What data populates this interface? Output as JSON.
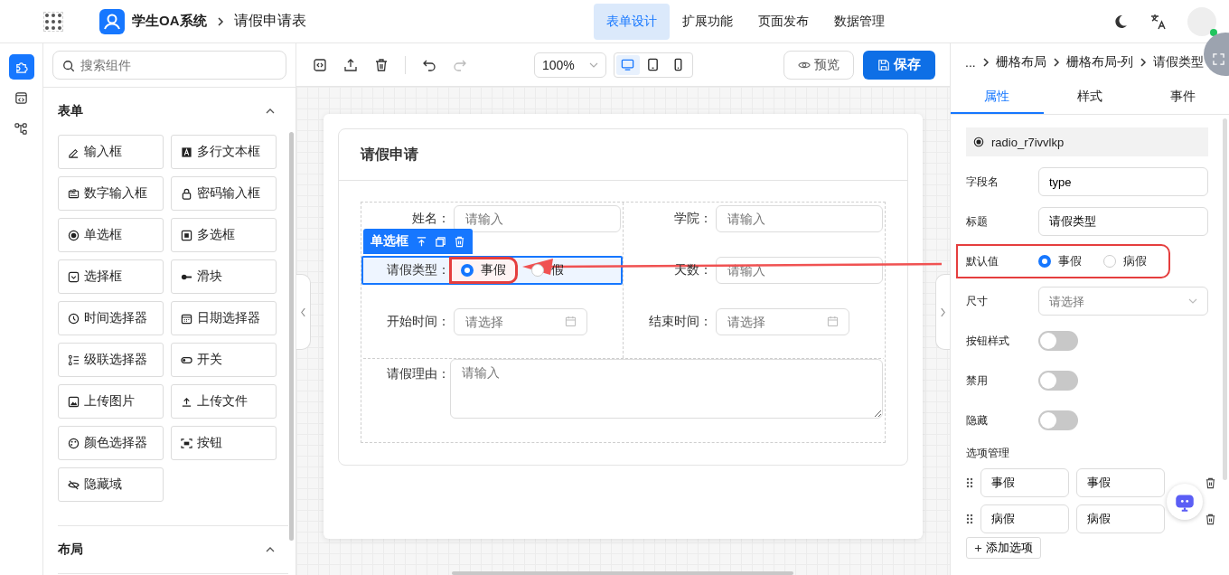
{
  "top_bar": {
    "app_name": "学生OA系统",
    "page_title": "请假申请表",
    "nav_tabs": [
      {
        "label": "表单设计",
        "selected": true
      },
      {
        "label": "扩展功能",
        "selected": false
      },
      {
        "label": "页面发布",
        "selected": false
      },
      {
        "label": "数据管理",
        "selected": false
      }
    ]
  },
  "sidebar_icons": [
    {
      "kind": "puzzle",
      "selected": true
    },
    {
      "kind": "code",
      "selected": false
    },
    {
      "kind": "tree",
      "selected": false
    }
  ],
  "component_panel": {
    "search": {
      "placeholder": "搜索组件"
    },
    "groups": [
      {
        "title": "表单",
        "expanded": true,
        "items": [
          {
            "label": "输入框",
            "kind": "pen"
          },
          {
            "label": "多行文本框",
            "kind": "textarea"
          },
          {
            "label": "数字输入框",
            "kind": "number"
          },
          {
            "label": "密码输入框",
            "kind": "lock"
          },
          {
            "label": "单选框",
            "kind": "radio"
          },
          {
            "label": "多选框",
            "kind": "checkbox"
          },
          {
            "label": "选择框",
            "kind": "select"
          },
          {
            "label": "滑块",
            "kind": "slider"
          },
          {
            "label": "时间选择器",
            "kind": "clock"
          },
          {
            "label": "日期选择器",
            "kind": "calendar"
          },
          {
            "label": "级联选择器",
            "kind": "cascade"
          },
          {
            "label": "开关",
            "kind": "switch"
          },
          {
            "label": "上传图片",
            "kind": "image"
          },
          {
            "label": "上传文件",
            "kind": "upload"
          },
          {
            "label": "颜色选择器",
            "kind": "palette"
          },
          {
            "label": "按钮",
            "kind": "button"
          },
          {
            "label": "隐藏域",
            "kind": "hidden"
          }
        ]
      },
      {
        "title": "布局",
        "expanded": true
      }
    ]
  },
  "toolbar": {
    "zoom": "100%",
    "devices": [
      {
        "kind": "desktop",
        "selected": true
      },
      {
        "kind": "tablet",
        "selected": false
      },
      {
        "kind": "phone",
        "selected": false
      }
    ],
    "preview": "预览",
    "save": "保存"
  },
  "form": {
    "title": "请假申请",
    "selection_toolbar": {
      "label": "单选框"
    },
    "columns": [
      {
        "fields": [
          {
            "label": "姓名：",
            "kind": "input",
            "placeholder": "请输入",
            "selected": false
          },
          {
            "label": "请假类型：",
            "kind": "radio",
            "selected": true,
            "options": [
              {
                "label": "事假",
                "selected": true,
                "highlighted": true
              },
              {
                "label": "假",
                "selected": false,
                "highlighted": false
              }
            ]
          },
          {
            "label": "开始时间：",
            "kind": "date",
            "placeholder": "请选择",
            "selected": false
          }
        ]
      },
      {
        "fields": [
          {
            "label": "学院：",
            "kind": "input",
            "placeholder": "请输入",
            "selected": false
          },
          {
            "label": "天数：",
            "kind": "input",
            "placeholder": "请输入",
            "selected": false
          },
          {
            "label": "结束时间：",
            "kind": "date",
            "placeholder": "请选择",
            "selected": false
          }
        ]
      }
    ],
    "full_width": [
      {
        "label": "请假理由：",
        "kind": "textarea",
        "placeholder": "请输入",
        "selected": false
      }
    ]
  },
  "properties": {
    "breadcrumb": [
      "...",
      "栅格布局",
      "栅格布局-列",
      "请假类型"
    ],
    "tabs": [
      {
        "label": "属性",
        "selected": true
      },
      {
        "label": "样式",
        "selected": false
      },
      {
        "label": "事件",
        "selected": false
      }
    ],
    "component_id": "radio_r7ivvlkp",
    "rows": [
      {
        "label": "字段名",
        "kind": "input",
        "value": "type",
        "highlighted": false
      },
      {
        "label": "标题",
        "kind": "input",
        "value": "请假类型",
        "highlighted": false
      },
      {
        "label": "默认值",
        "kind": "radio",
        "highlighted": true,
        "options": [
          {
            "label": "事假",
            "selected": true
          },
          {
            "label": "病假",
            "selected": false
          }
        ]
      },
      {
        "label": "尺寸",
        "kind": "select",
        "placeholder": "请选择",
        "highlighted": false
      },
      {
        "label": "按钮样式",
        "kind": "switch",
        "on": false,
        "highlighted": false
      },
      {
        "label": "禁用",
        "kind": "switch",
        "on": false,
        "highlighted": false
      },
      {
        "label": "隐藏",
        "kind": "switch",
        "on": false,
        "highlighted": false
      }
    ],
    "options_manager": {
      "title": "选项管理",
      "options": [
        {
          "label": "事假",
          "value": "事假"
        },
        {
          "label": "病假",
          "value": "病假"
        }
      ],
      "add_button": "添加选项"
    }
  }
}
